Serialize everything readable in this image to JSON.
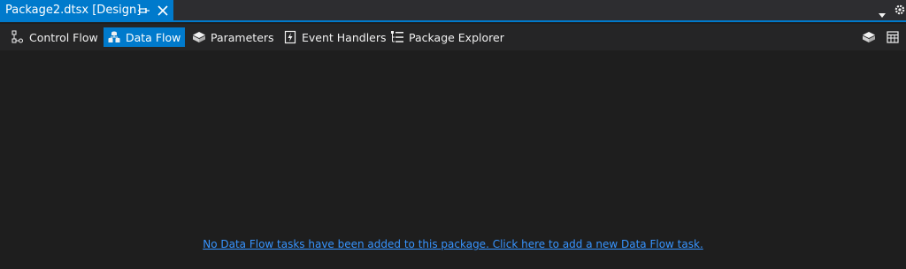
{
  "document_tab": {
    "title": "Package2.dtsx [Design]",
    "pin_icon": "pin-icon",
    "close_icon": "close-icon"
  },
  "tab_strip": {
    "dropdown_icon": "dropdown-icon",
    "gear_icon": "gear-icon"
  },
  "designer_tabs": [
    {
      "label": "Control Flow",
      "icon": "control-flow-icon",
      "active": false
    },
    {
      "label": "Data Flow",
      "icon": "data-flow-icon",
      "active": true
    },
    {
      "label": "Parameters",
      "icon": "parameters-icon",
      "active": false
    },
    {
      "label": "Event Handlers",
      "icon": "event-handlers-icon",
      "active": false
    },
    {
      "label": "Package Explorer",
      "icon": "package-explorer-icon",
      "active": false
    }
  ],
  "designer_toolbar_right": [
    {
      "icon": "variables-icon"
    },
    {
      "icon": "grid-icon"
    }
  ],
  "canvas": {
    "empty_message": "No Data Flow tasks have been added to this package. Click here to add a new Data Flow task."
  },
  "colors": {
    "accent": "#007acc",
    "background": "#1e1e1e",
    "link": "#3794ff"
  }
}
